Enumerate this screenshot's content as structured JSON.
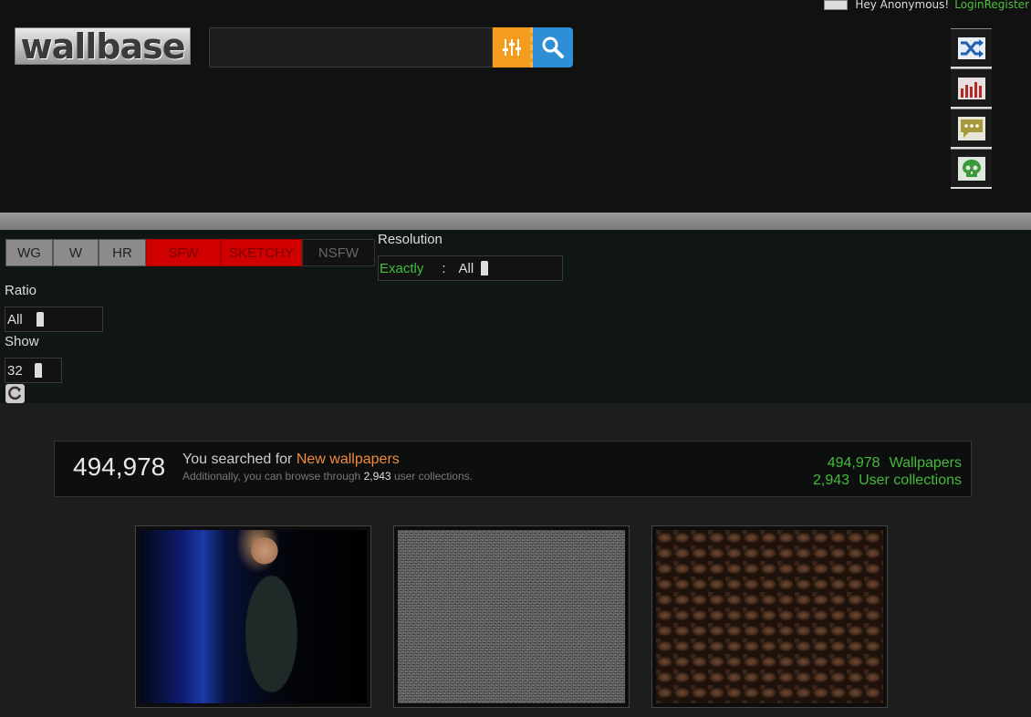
{
  "header": {
    "greeting": "Hey Anonymous!",
    "login_label": "Login",
    "register_label": "Register",
    "logo_text": "wallbase"
  },
  "search": {
    "value": "",
    "placeholder": ""
  },
  "side_icons": [
    "shuffle-icon",
    "bar-chart-icon",
    "chat-bubble-icon",
    "skull-icon"
  ],
  "filters": {
    "purity": [
      "WG",
      "W",
      "HR",
      "SFW",
      "SKETCHY",
      "NSFW"
    ],
    "resolution_label": "Resolution",
    "resolution_mode": "Exactly",
    "resolution_sep": ":",
    "resolution_value": "All",
    "ratio_label": "Ratio",
    "ratio_value": "All",
    "show_label": "Show",
    "show_value": "32"
  },
  "summary": {
    "count": "494,978",
    "searched_prefix": "You searched for",
    "searched_term": "New wallpapers",
    "collections_prefix": "Additionally, you can browse through",
    "collections_count": "2,943",
    "collections_suffix": "user collections.",
    "stat_wallpapers_num": "494,978",
    "stat_wallpapers_label": "Wallpapers",
    "stat_collections_num": "2,943",
    "stat_collections_label": "User collections"
  },
  "colors": {
    "accent_green": "#46b83b",
    "accent_orange": "#f08a3c",
    "purity_red": "#d10000"
  }
}
